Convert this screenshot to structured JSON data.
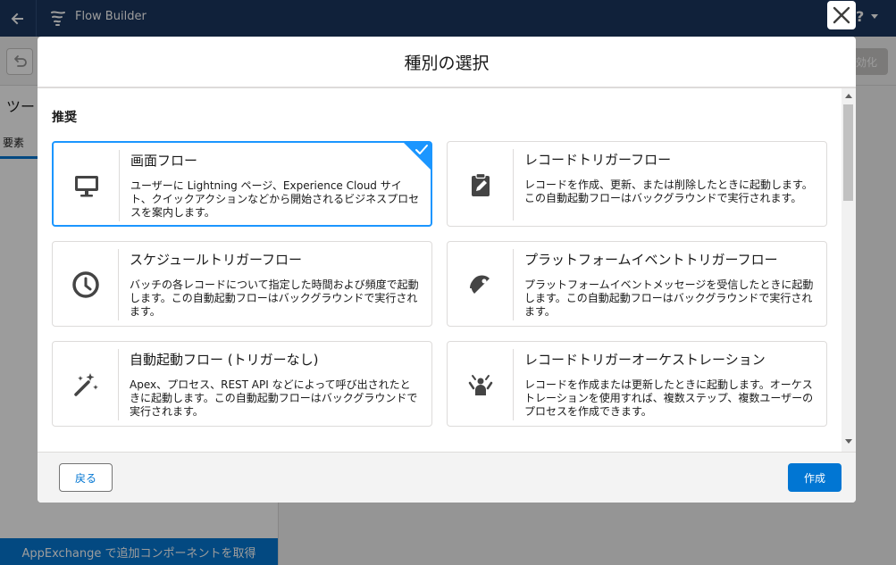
{
  "app": {
    "name": "Flow Builder",
    "left_panel_title": "ツー",
    "left_panel_tab": "要素",
    "activate_label": "効化",
    "help_label": "?",
    "appexchange_label": "AppExchange で追加コンポーネントを取得"
  },
  "modal": {
    "title": "種別の選択",
    "section_title": "推奨",
    "cards": [
      {
        "label": "画面フロー",
        "description": "ユーザーに Lightning ページ、Experience Cloud サイト、クイックアクションなどから開始されるビジネスプロセスを案内します。",
        "icon": "desktop-icon",
        "selected": true
      },
      {
        "label": "レコードトリガーフロー",
        "description": "レコードを作成、更新、または削除したときに起動します。この自動起動フローはバックグラウンドで実行されます。",
        "icon": "clipboard-edit-icon",
        "selected": false
      },
      {
        "label": "スケジュールトリガーフロー",
        "description": "バッチの各レコードについて指定した時間および頻度で起動します。この自動起動フローはバックグラウンドで実行されます。",
        "icon": "clock-icon",
        "selected": false
      },
      {
        "label": "プラットフォームイベントトリガーフロー",
        "description": "プラットフォームイベントメッセージを受信したときに起動します。この自動起動フローはバックグラウンドで実行されます。",
        "icon": "broadcast-icon",
        "selected": false
      },
      {
        "label": "自動起動フロー (トリガーなし)",
        "description": "Apex、プロセス、REST API などによって呼び出されたときに起動します。この自動起動フローはバックグラウンドで実行されます。",
        "icon": "magic-wand-icon",
        "selected": false
      },
      {
        "label": "レコードトリガーオーケストレーション",
        "description": "レコードを作成または更新したときに起動します。オーケストレーションを使用すれば、複数ステップ、複数ユーザーのプロセスを作成できます。",
        "icon": "orchestrator-icon",
        "selected": false
      }
    ],
    "back_label": "戻る",
    "create_label": "作成"
  },
  "colors": {
    "brand_blue": "#0176d3",
    "selection_blue": "#1b96ff",
    "header_navy": "#16325c"
  }
}
